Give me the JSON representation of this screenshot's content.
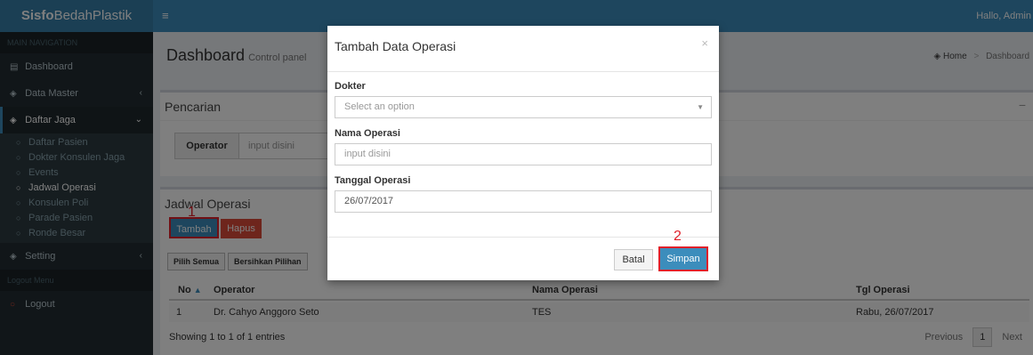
{
  "app": {
    "brand_bold": "Sisfo",
    "brand_rest": "BedahPlastik",
    "toggle_icon": "≡",
    "greeting": "Hallo, Admin"
  },
  "sidebar": {
    "header_main": "MAIN NAVIGATION",
    "items": [
      {
        "icon": "▤",
        "label": "Dashboard"
      },
      {
        "icon": "◈",
        "label": "Data Master",
        "chev": "‹"
      },
      {
        "icon": "◈",
        "label": "Daftar Jaga",
        "chev": "⌄"
      }
    ],
    "sub_items": [
      "Daftar Pasien",
      "Dokter Konsulen Jaga",
      "Events",
      "Jadwal Operasi",
      "Konsulen Poli",
      "Parade Pasien",
      "Ronde Besar"
    ],
    "setting": {
      "icon": "◈",
      "label": "Setting",
      "chev": "‹"
    },
    "header_logout": "Logout Menu",
    "logout": "Logout"
  },
  "content": {
    "title": "Dashboard",
    "subtitle": "Control panel",
    "breadcrumb": {
      "home": "Home",
      "current": "Dashboard"
    },
    "search_box": {
      "title": "Pencarian",
      "collapse": "−",
      "operator_label": "Operator",
      "placeholder": "input disini"
    },
    "schedule_box": {
      "title": "Jadwal Operasi",
      "marker": "1",
      "add_button": "Tambah",
      "delete_button": "Hapus",
      "select_all": "Pilih Semua",
      "clear_selection": "Bersihkan Pilihan",
      "columns": [
        "No",
        "Operator",
        "Nama Operasi",
        "Tgl Operasi"
      ],
      "rows": [
        {
          "no": "1",
          "operator": "Dr. Cahyo Anggoro Seto",
          "nama_operasi": "TES",
          "tgl_operasi": "Rabu, 26/07/2017"
        }
      ],
      "showing": "Showing 1 to 1 of 1 entries",
      "pager": {
        "prev": "Previous",
        "page": "1",
        "next": "Next"
      }
    }
  },
  "modal": {
    "title": "Tambah Data Operasi",
    "close": "×",
    "doctor_label": "Dokter",
    "doctor_placeholder": "Select an option",
    "name_label": "Nama Operasi",
    "name_placeholder": "input disini",
    "date_label": "Tanggal Operasi",
    "date_value": "26/07/2017",
    "cancel_button": "Batal",
    "save_button": "Simpan",
    "marker": "2"
  }
}
